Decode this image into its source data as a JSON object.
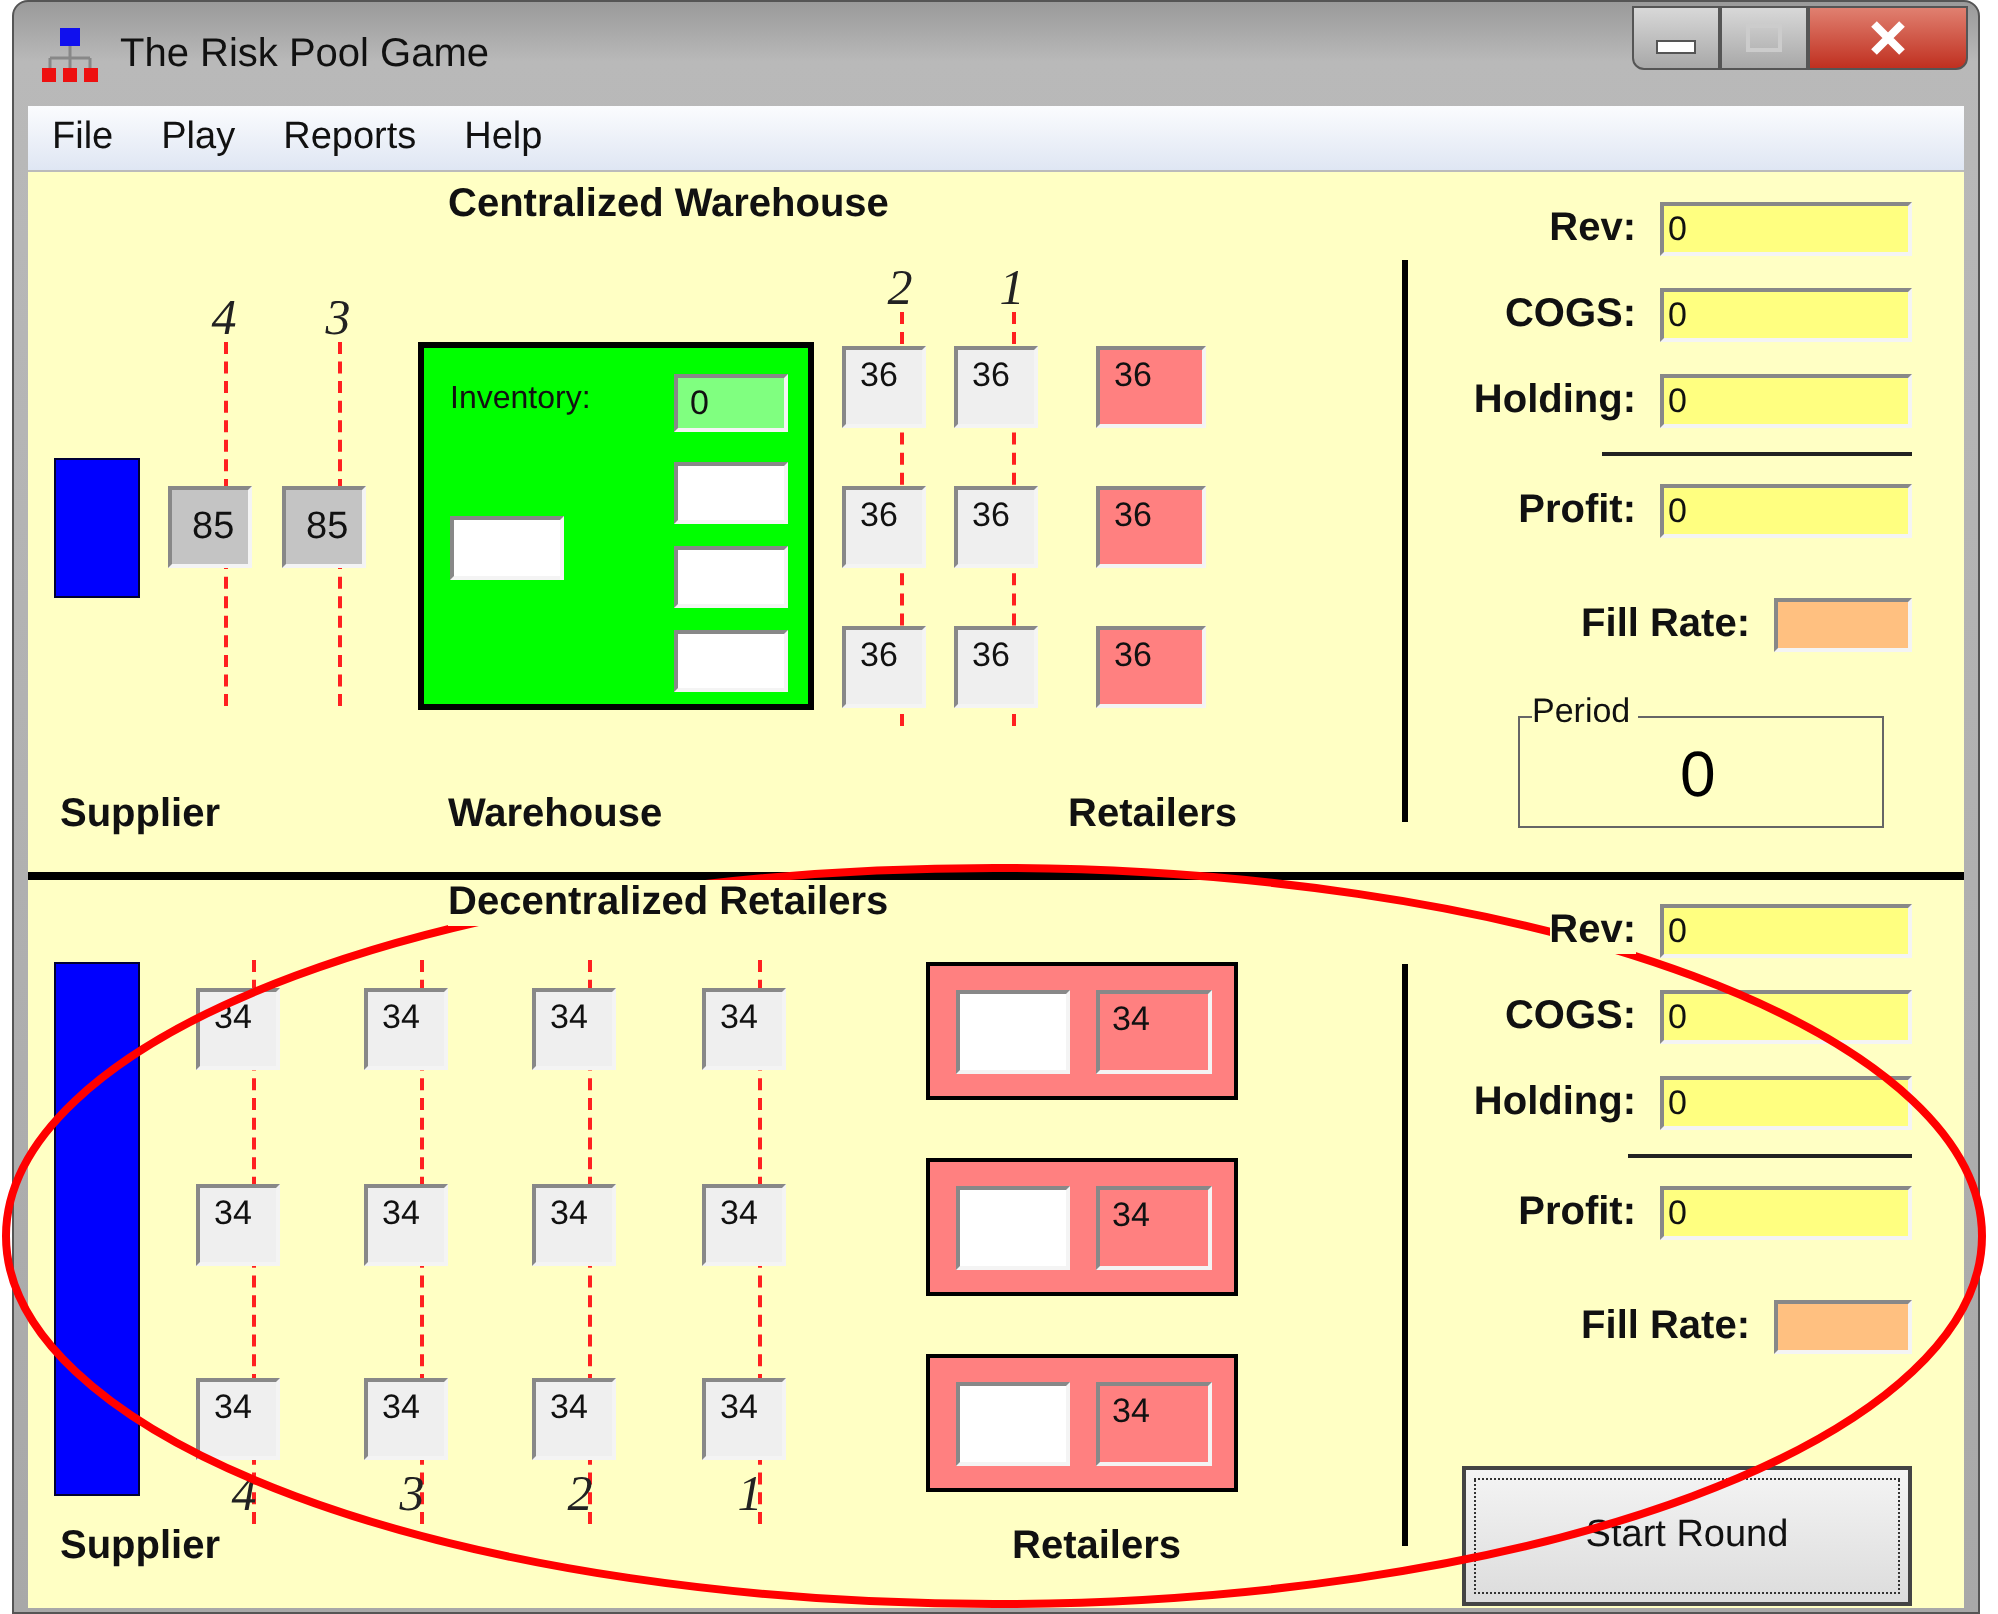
{
  "window": {
    "title": "The Risk Pool Game"
  },
  "menu": [
    "File",
    "Play",
    "Reports",
    "Help"
  ],
  "centralized": {
    "title": "Centralized Warehouse",
    "upstream_lanes": [
      {
        "label": "4",
        "value": "85"
      },
      {
        "label": "3",
        "value": "85"
      }
    ],
    "warehouse": {
      "inventory_label": "Inventory:",
      "inventory": "0"
    },
    "downstream_lanes": [
      {
        "label": "2",
        "values": [
          "36",
          "36",
          "36"
        ]
      },
      {
        "label": "1",
        "values": [
          "36",
          "36",
          "36"
        ]
      }
    ],
    "retailers": [
      "36",
      "36",
      "36"
    ],
    "labels": {
      "supplier": "Supplier",
      "warehouse": "Warehouse",
      "retailers": "Retailers"
    },
    "stats": [
      {
        "kind": "field",
        "label": "Rev:",
        "value": "0"
      },
      {
        "kind": "field",
        "label": "COGS:",
        "value": "0"
      },
      {
        "kind": "field",
        "label": "Holding:",
        "value": "0"
      },
      {
        "kind": "divider"
      },
      {
        "kind": "field",
        "label": "Profit:",
        "value": "0"
      },
      {
        "kind": "rate",
        "label": "Fill Rate:"
      }
    ],
    "period": {
      "label": "Period",
      "value": "0"
    }
  },
  "decentralized": {
    "title": "Decentralized Retailers",
    "lanes": [
      {
        "label": "4",
        "values": [
          "34",
          "34",
          "34"
        ]
      },
      {
        "label": "3",
        "values": [
          "34",
          "34",
          "34"
        ]
      },
      {
        "label": "2",
        "values": [
          "34",
          "34",
          "34"
        ]
      },
      {
        "label": "1",
        "values": [
          "34",
          "34",
          "34"
        ]
      }
    ],
    "retailers": [
      "34",
      "34",
      "34"
    ],
    "labels": {
      "supplier": "Supplier",
      "retailers": "Retailers"
    },
    "stats": [
      {
        "kind": "field",
        "label": "Rev:",
        "value": "0"
      },
      {
        "kind": "field",
        "label": "COGS:",
        "value": "0"
      },
      {
        "kind": "field",
        "label": "Holding:",
        "value": "0"
      },
      {
        "kind": "divider"
      },
      {
        "kind": "field",
        "label": "Profit:",
        "value": "0"
      },
      {
        "kind": "rate",
        "label": "Fill Rate:"
      }
    ],
    "button": "Start Round"
  },
  "annotation": {
    "kind": "ellipse",
    "color": "#ff0000"
  }
}
